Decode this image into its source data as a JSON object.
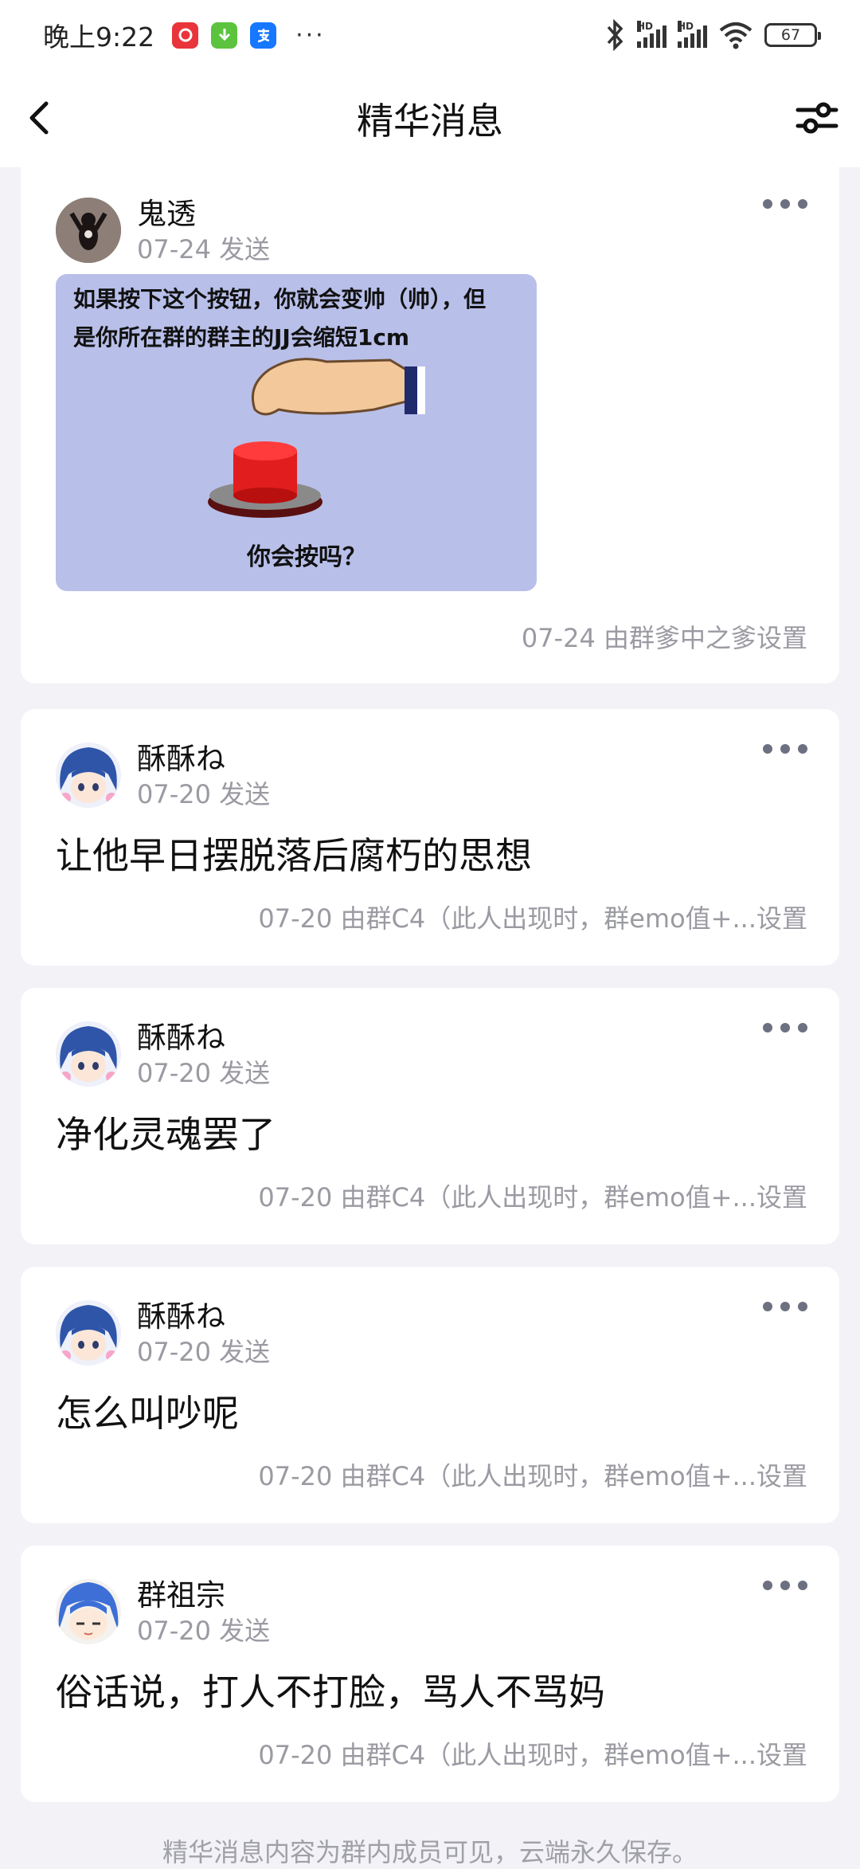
{
  "status_bar": {
    "time": "晚上9:22",
    "more": "···",
    "battery": "67",
    "signal_label": "HD",
    "app_icons": [
      "netease-music-icon",
      "download-icon",
      "alipay-icon"
    ]
  },
  "nav": {
    "title": "精华消息"
  },
  "posts": [
    {
      "name": "鬼透",
      "date": "07-24 发送",
      "image": {
        "line1": "如果按下这个按钮，你就会变帅（帅），但",
        "line2": "是你所在群的群主的JJ会缩短1cm",
        "caption": "你会按吗？"
      },
      "meta": "07-24 由群爹中之爹设置"
    },
    {
      "name": "酥酥ね",
      "date": "07-20 发送",
      "text": "让他早日摆脱落后腐朽的思想",
      "meta": "07-20 由群C4（此人出现时，群emo值+...设置"
    },
    {
      "name": "酥酥ね",
      "date": "07-20 发送",
      "text": "净化灵魂罢了",
      "meta": "07-20 由群C4（此人出现时，群emo值+...设置"
    },
    {
      "name": "酥酥ね",
      "date": "07-20 发送",
      "text": "怎么叫吵呢",
      "meta": "07-20 由群C4（此人出现时，群emo值+...设置"
    },
    {
      "name": "群祖宗",
      "date": "07-20 发送",
      "text": "俗话说，打人不打脸，骂人不骂妈",
      "meta": "07-20 由群C4（此人出现时，群emo值+...设置"
    }
  ],
  "footer_note": "精华消息内容为群内成员可见，云端永久保存。",
  "colors": {
    "background": "#f2f2f7",
    "card": "#ffffff",
    "secondary_text": "#9a9aa2",
    "meme_bg": "#b8bfe9",
    "button_red": "#e11d1d"
  }
}
